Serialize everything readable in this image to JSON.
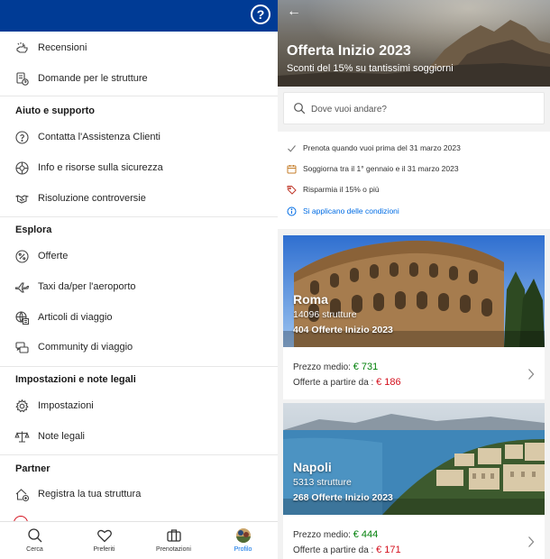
{
  "left": {
    "help_icon_glyph": "?",
    "items_top": [
      {
        "label": "Recensioni",
        "icon": "review-hand-icon"
      },
      {
        "label": "Domande per le strutture",
        "icon": "question-doc-icon"
      }
    ],
    "sections": [
      {
        "title": "Aiuto e supporto",
        "items": [
          {
            "label": "Contatta l'Assistenza Clienti",
            "icon": "question-circle-icon"
          },
          {
            "label": "Info e risorse sulla sicurezza",
            "icon": "safety-icon"
          },
          {
            "label": "Risoluzione controversie",
            "icon": "handshake-icon"
          }
        ]
      },
      {
        "title": "Esplora",
        "items": [
          {
            "label": "Offerte",
            "icon": "percent-icon"
          },
          {
            "label": "Taxi da/per l'aeroporto",
            "icon": "plane-icon"
          },
          {
            "label": "Articoli di viaggio",
            "icon": "globe-article-icon"
          },
          {
            "label": "Community di viaggio",
            "icon": "community-icon"
          }
        ]
      },
      {
        "title": "Impostazioni e note legali",
        "items": [
          {
            "label": "Impostazioni",
            "icon": "gear-icon"
          },
          {
            "label": "Note legali",
            "icon": "scales-icon"
          }
        ]
      },
      {
        "title": "Partner",
        "items": [
          {
            "label": "Registra la tua struttura",
            "icon": "house-add-icon"
          }
        ]
      }
    ],
    "bottom_nav": [
      {
        "label": "Cerca",
        "icon": "search-icon"
      },
      {
        "label": "Preferiti",
        "icon": "heart-icon"
      },
      {
        "label": "Prenotazioni",
        "icon": "suitcase-icon"
      },
      {
        "label": "Profilo",
        "icon": "avatar-icon",
        "active": true
      }
    ]
  },
  "right": {
    "back_glyph": "←",
    "hero_title": "Offerta Inizio 2023",
    "hero_subtitle": "Sconti del 15% su tantissimi soggiorni",
    "search_placeholder": "Dove vuoi andare?",
    "info": [
      {
        "text": "Prenota quando vuoi prima del 31 marzo 2023",
        "icon": "check-icon"
      },
      {
        "text": "Soggiorna tra il 1° gennaio e il 31 marzo 2023",
        "icon": "calendar-icon"
      },
      {
        "text": "Risparmia il 15% o più",
        "icon": "tag-icon"
      },
      {
        "text": "Si applicano delle condizioni",
        "icon": "info-icon",
        "link": true
      }
    ],
    "destinations": [
      {
        "name": "Roma",
        "count": "14096 strutture",
        "offers": "404 Offerte Inizio 2023",
        "avg_label": "Prezzo medio:",
        "avg_price": "€ 731",
        "from_label": "Offerte a partire da :",
        "from_price": "€ 186"
      },
      {
        "name": "Napoli",
        "count": "5313 strutture",
        "offers": "268 Offerte Inizio 2023",
        "avg_label": "Prezzo medio:",
        "avg_price": "€ 444",
        "from_label": "Offerte a partire da :",
        "from_price": "€ 171"
      }
    ]
  },
  "colors": {
    "brand_blue": "#003b95",
    "link_blue": "#006ce4",
    "price_green": "#008009",
    "price_red": "#d4111e"
  }
}
